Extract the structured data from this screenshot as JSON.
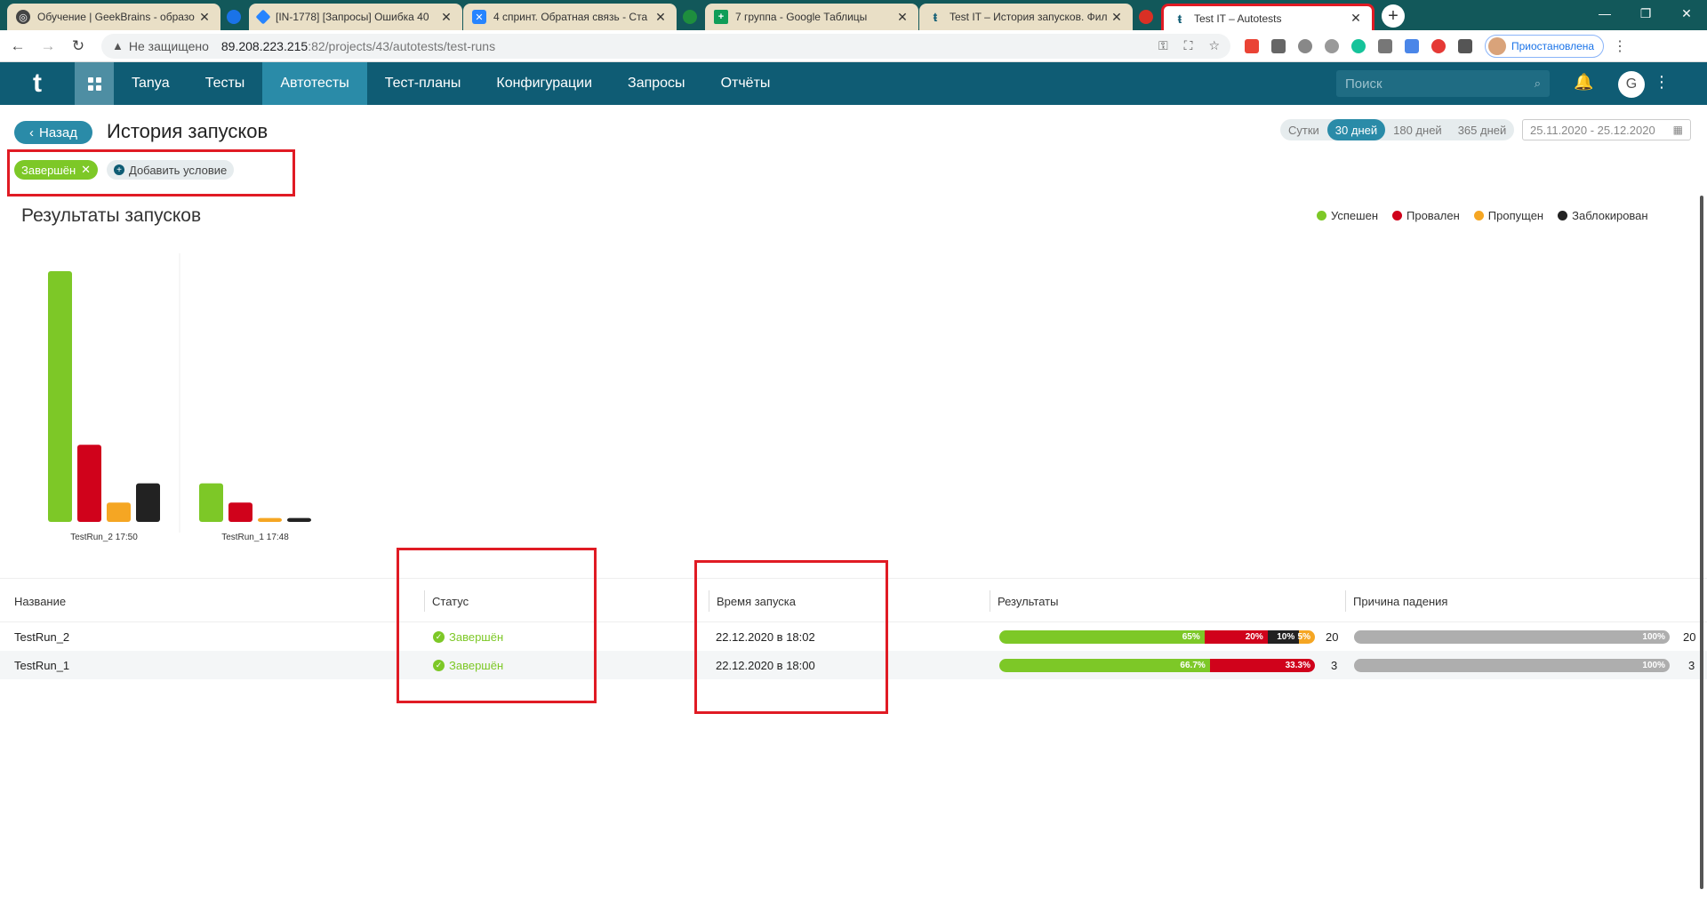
{
  "browser": {
    "tabs": [
      {
        "title": "Обучение | GeekBrains - образо",
        "icon_color": "#333333",
        "icon": "gb-icon"
      },
      {
        "title": "",
        "icon_color": "#1a73e8",
        "icon": "circle-icon"
      },
      {
        "title": "[IN-1778] [Запросы] Ошибка 40",
        "icon_color": "#2684ff",
        "icon": "jira-icon"
      },
      {
        "title": "4 спринт. Обратная связь - Ста",
        "icon_color": "#2684ff",
        "icon": "confluence-icon"
      },
      {
        "title": "",
        "icon_color": "#1e8e3e",
        "icon": "circle-icon"
      },
      {
        "title": "7 группа - Google Таблицы",
        "icon_color": "#0f9d58",
        "icon": "sheets-icon"
      },
      {
        "title": "Test IT – История запусков. Фил",
        "icon_color": "#0f5c74",
        "icon": "testit-icon"
      },
      {
        "title": "",
        "icon_color": "#d93025",
        "icon": "circle-icon"
      },
      {
        "title": "Test IT – Autotests",
        "icon_color": "#0f5c74",
        "icon": "testit-icon",
        "active": true
      }
    ],
    "address": {
      "security_label": "Не защищено",
      "host": "89.208.223.215",
      "path": ":82/projects/43/autotests/test-runs"
    },
    "profile_label": "Приостановлена"
  },
  "app": {
    "logo": "t",
    "nav": [
      "Tanya",
      "Тесты",
      "Автотесты",
      "Тест-планы",
      "Конфигурации",
      "Запросы",
      "Отчёты"
    ],
    "active_nav": "Автотесты",
    "search_placeholder": "Поиск",
    "user_initial": "G"
  },
  "page": {
    "back_label": "Назад",
    "title": "История запусков",
    "periods": [
      "Сутки",
      "30 дней",
      "180 дней",
      "365 дней"
    ],
    "selected_period": "30 дней",
    "date_range": "25.11.2020 - 25.12.2020",
    "filters": {
      "chip": "Завершён",
      "add_label": "Добавить условие"
    },
    "results_title": "Результаты запусков",
    "legend": [
      {
        "label": "Успешен",
        "color": "#7dc827"
      },
      {
        "label": "Провален",
        "color": "#d0021b"
      },
      {
        "label": "Пропущен",
        "color": "#f5a623"
      },
      {
        "label": "Заблокирован",
        "color": "#222222"
      }
    ]
  },
  "chart_data": {
    "type": "bar",
    "categories": [
      "TestRun_2 17:50",
      "TestRun_1 17:48"
    ],
    "series": [
      {
        "name": "Успешен",
        "color": "#7dc827",
        "values": [
          13,
          2
        ]
      },
      {
        "name": "Провален",
        "color": "#d0021b",
        "values": [
          4,
          1
        ]
      },
      {
        "name": "Пропущен",
        "color": "#f5a623",
        "values": [
          1,
          0.2
        ]
      },
      {
        "name": "Заблокирован",
        "color": "#222222",
        "values": [
          2,
          0.2
        ]
      }
    ],
    "ylim": [
      0,
      13
    ],
    "title": "Результаты запусков",
    "xlabel": "",
    "ylabel": ""
  },
  "table": {
    "headers": [
      "Название",
      "Статус",
      "Время запуска",
      "Результаты",
      "Причина падения"
    ],
    "rows": [
      {
        "name": "TestRun_2",
        "status": "Завершён",
        "time": "22.12.2020 в 18:02",
        "results": [
          {
            "label": "65%",
            "pct": 65,
            "color": "#7dc827"
          },
          {
            "label": "20%",
            "pct": 20,
            "color": "#d0021b"
          },
          {
            "label": "10%",
            "pct": 10,
            "color": "#222222"
          },
          {
            "label": "5%",
            "pct": 5,
            "color": "#f5a623"
          }
        ],
        "results_count": "20",
        "fail_label": "100%",
        "fail_pct": 100,
        "fail_count": "20"
      },
      {
        "name": "TestRun_1",
        "status": "Завершён",
        "time": "22.12.2020 в 18:00",
        "results": [
          {
            "label": "66.7%",
            "pct": 66.7,
            "color": "#7dc827"
          },
          {
            "label": "33.3%",
            "pct": 33.3,
            "color": "#d0021b"
          }
        ],
        "results_count": "3",
        "fail_label": "100%",
        "fail_pct": 100,
        "fail_count": "3"
      }
    ]
  }
}
